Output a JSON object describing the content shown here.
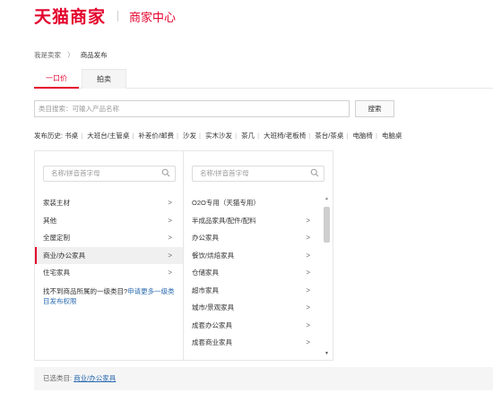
{
  "header": {
    "logo": "天猫商家",
    "subtitle": "商家中心"
  },
  "breadcrumb": {
    "home": "我是卖家",
    "separator": "〉",
    "current": "商品发布"
  },
  "tabs": [
    {
      "label": "一口价"
    },
    {
      "label": "拍卖"
    }
  ],
  "search": {
    "placeholder": "类目搜索：可输入产品名称",
    "button": "搜索"
  },
  "history": {
    "label": "发布历史:",
    "items": [
      "书桌",
      "大班台/主管桌",
      "补差价/邮费",
      "沙发",
      "实木沙发",
      "茶几",
      "大班椅/老板椅",
      "茶台/茶桌",
      "电脑椅",
      "电脑桌"
    ]
  },
  "col1": {
    "search_placeholder": "名称/拼音首字母",
    "items": [
      {
        "label": "家装主材"
      },
      {
        "label": "其他"
      },
      {
        "label": "全屋定制"
      },
      {
        "label": "商业/办公家具"
      },
      {
        "label": "住宅家具"
      }
    ],
    "missing_text": "找不到商品所属的一级类目?",
    "missing_link": "申请更多一级类目发布权限"
  },
  "col2": {
    "search_placeholder": "名称/拼音首字母",
    "items": [
      {
        "label": "O2O专用（天猫专用）"
      },
      {
        "label": "半成品家具/配件/配料"
      },
      {
        "label": "办公家具"
      },
      {
        "label": "餐饮/烘焙家具"
      },
      {
        "label": "仓储家具"
      },
      {
        "label": "超市家具"
      },
      {
        "label": "城市/景观家具"
      },
      {
        "label": "成套办公家具"
      },
      {
        "label": "成套商业家具"
      }
    ]
  },
  "selected": {
    "label": "已选类目:",
    "value": "商业/办公家具"
  },
  "colors": {
    "brand_red": "#e4022d",
    "link_blue": "#2a6bb0"
  },
  "icons": {
    "chevron": ">",
    "search": "magnifier-icon"
  }
}
